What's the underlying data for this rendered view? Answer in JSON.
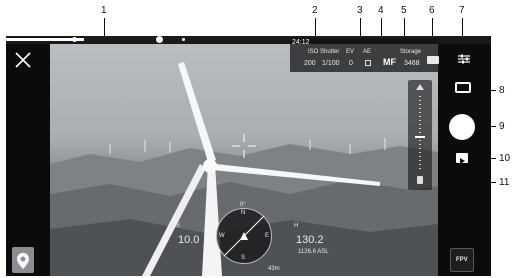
{
  "callouts": [
    "1",
    "2",
    "3",
    "4",
    "5",
    "6",
    "7",
    "8",
    "9",
    "10",
    "11"
  ],
  "status": {
    "time": "24:12",
    "iso_label": "ISO",
    "shutter_label": "Shutter",
    "ev_label": "EV",
    "mode_label": "AE",
    "storage_label": "Storage",
    "iso_value": "200",
    "shutter_value": "1/100",
    "ev_value": "0",
    "focus_mode": "MF",
    "storage_value": "3468",
    "flight_progress": 0.16
  },
  "telemetry": {
    "h_speed_label": "H.S",
    "h_speed_value": "10.0",
    "altitude_label": "H",
    "altitude_value": "130.2",
    "asl_value": "1126.6 ASL",
    "compass_n": "N",
    "compass_w": "W",
    "compass_e": "E",
    "compass_s": "S",
    "distance_value": "43m",
    "heading_value": "0°"
  },
  "buttons": {
    "fpv_label": "FPV"
  },
  "colors": {
    "screen_bg": "#0b0b0b",
    "accent": "#ffffff",
    "callout": "#111111"
  }
}
